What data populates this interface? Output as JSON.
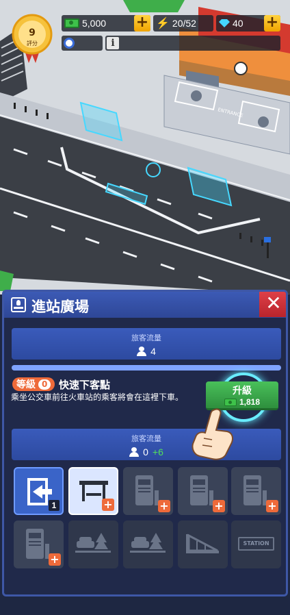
{
  "hud": {
    "rating": {
      "value": "9",
      "label": "評分"
    },
    "cash": {
      "value": "5,000"
    },
    "energy": {
      "value": "20/52"
    },
    "gems": {
      "value": "40"
    },
    "plus_symbol": "+"
  },
  "world": {
    "entrance_label": "ENTRANCE",
    "colors": {
      "road": "#3b3f46",
      "sidewalk": "#c7ccd3",
      "hologram": "#46d8ff",
      "station_roof": "#d43a2f",
      "station_wall": "#e8923a"
    }
  },
  "panel": {
    "title": "進站廣場",
    "close_symbol": "✕",
    "passenger_flow_top": {
      "label": "旅客流量",
      "value": "4"
    },
    "progress_fraction": 1.0,
    "level": {
      "label": "等級",
      "number": "0"
    },
    "stop_name": "快速下客點",
    "stop_description": "乘坐公交車前往火車站的乘客將會在這裡下車。",
    "upgrade": {
      "label": "升級",
      "cost": "1,818"
    },
    "passenger_flow_bottom": {
      "label": "旅客流量",
      "value": "0",
      "gain": "+6"
    },
    "slots": [
      {
        "icon": "entry-gate-icon",
        "badge": "1"
      },
      {
        "icon": "bus-shelter-icon",
        "badge": "+"
      },
      {
        "icon": "ticket-machine-icon",
        "badge": "+"
      },
      {
        "icon": "ticket-machine-icon",
        "badge": "+"
      },
      {
        "icon": "ticket-machine-icon",
        "badge": "+"
      },
      {
        "icon": "ticket-machine-icon",
        "badge": "+"
      },
      {
        "icon": "parking-lot-icon",
        "badge": ""
      },
      {
        "icon": "parking-lot-icon",
        "badge": ""
      },
      {
        "icon": "ramp-icon",
        "badge": ""
      },
      {
        "icon": "station-sign-icon",
        "text": "STATION"
      }
    ],
    "colors": {
      "accent": "#3a5bbb",
      "upgrade": "#49c05a",
      "level_badge": "#ee6a3a",
      "gain": "#52e05a",
      "close": "#d6303a"
    }
  }
}
